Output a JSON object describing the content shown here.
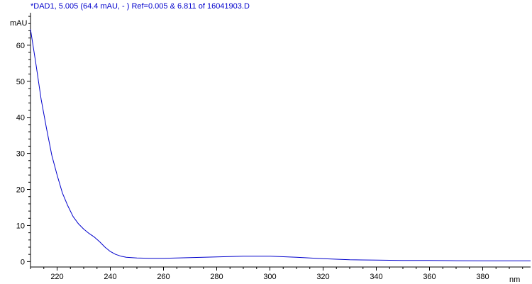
{
  "chart_data": {
    "type": "line",
    "title": "*DAD1, 5.005 (64.4 mAU, - ) Ref=0.005 & 6.811 of 16041903.D",
    "xlabel": "nm",
    "ylabel": "mAU",
    "xlim": [
      210,
      398
    ],
    "ylim": [
      -1.5,
      69
    ],
    "xticks": [
      220,
      240,
      260,
      280,
      300,
      320,
      340,
      360,
      380
    ],
    "yticks": [
      0,
      10,
      20,
      30,
      40,
      50,
      60
    ],
    "grid": false,
    "series": [
      {
        "color": "#0000cc",
        "x": [
          210,
          212,
          214,
          216,
          218,
          220,
          222,
          224,
          226,
          228,
          230,
          232,
          234,
          236,
          238,
          240,
          242,
          244,
          246,
          248,
          250,
          255,
          260,
          265,
          270,
          280,
          290,
          300,
          310,
          320,
          330,
          340,
          350,
          360,
          370,
          380,
          390,
          398
        ],
        "y": [
          64.4,
          55,
          45,
          37,
          29.5,
          24,
          19,
          15.5,
          12.5,
          10.5,
          9,
          7.8,
          6.8,
          5.5,
          4,
          2.8,
          2,
          1.5,
          1.2,
          1.1,
          1.0,
          0.9,
          0.9,
          1.0,
          1.1,
          1.3,
          1.5,
          1.5,
          1.2,
          0.8,
          0.5,
          0.4,
          0.3,
          0.3,
          0.25,
          0.2,
          0.2,
          0.2
        ]
      }
    ]
  },
  "colors": {
    "title": "#0000cc",
    "line": "#0000cc",
    "axis": "#000000"
  }
}
